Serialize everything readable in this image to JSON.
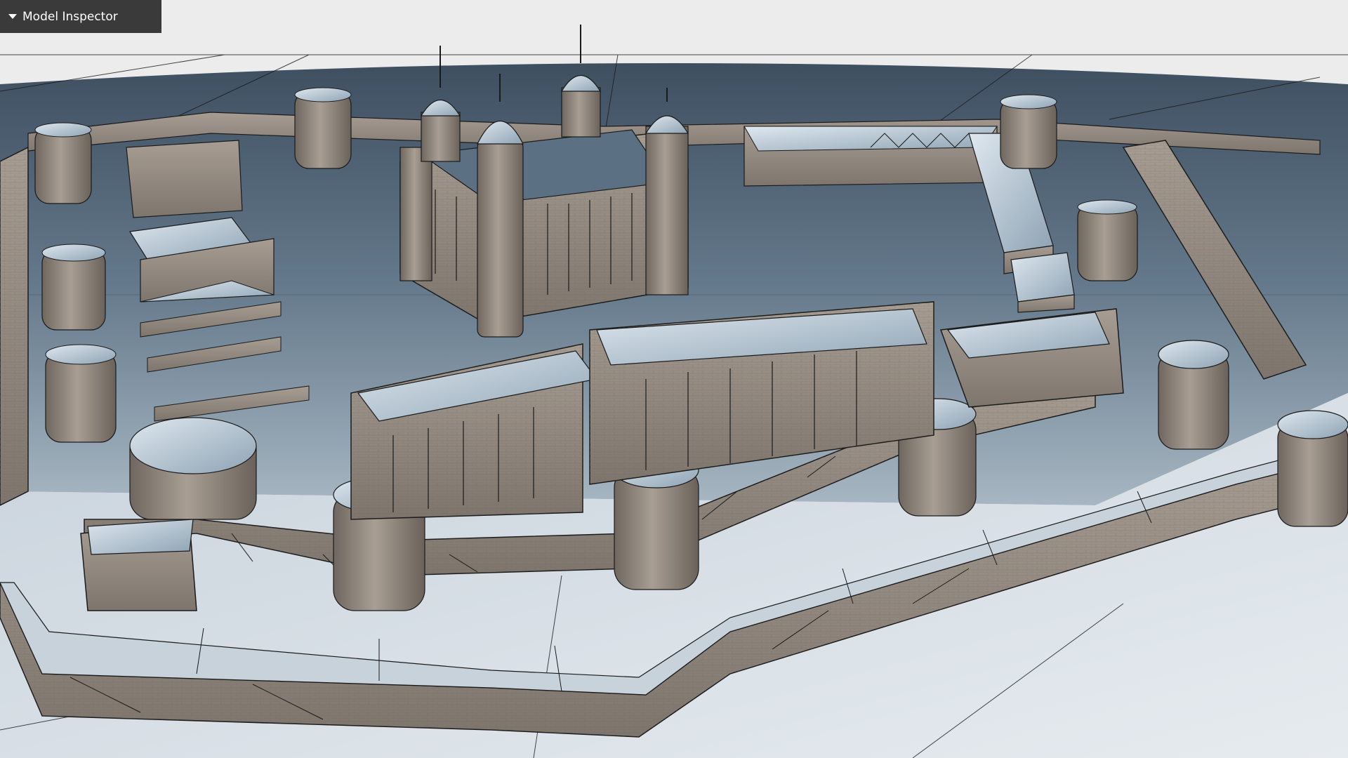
{
  "panel": {
    "title": "Model Inspector",
    "state": "collapsed",
    "toggle_icon": "caret-down-icon"
  },
  "viewport": {
    "content": "3d-castle-model",
    "render_mode": "textured-wireframe",
    "colors": {
      "background": "#ececec",
      "ground": "#5f7a90",
      "stone": "#9a9088",
      "roof": "#b7c6d2",
      "edge": "#1a1a1a",
      "panel": "#3a3a3a"
    }
  }
}
